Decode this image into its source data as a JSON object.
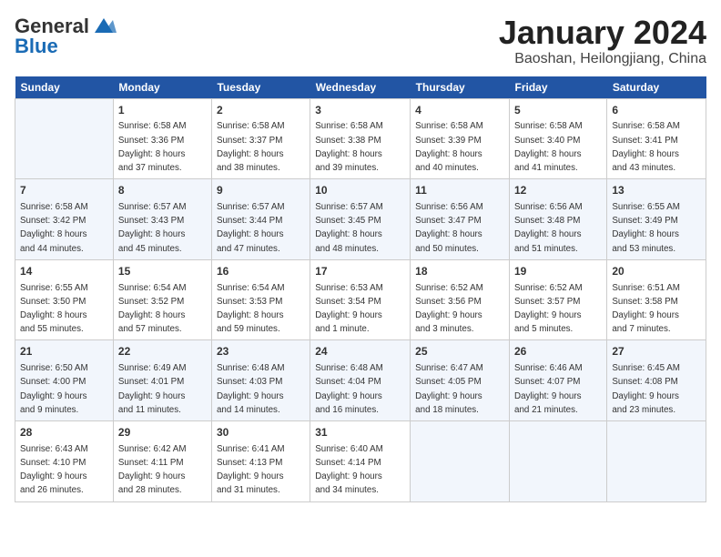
{
  "header": {
    "logo_general": "General",
    "logo_blue": "Blue",
    "month_year": "January 2024",
    "location": "Baoshan, Heilongjiang, China"
  },
  "days_of_week": [
    "Sunday",
    "Monday",
    "Tuesday",
    "Wednesday",
    "Thursday",
    "Friday",
    "Saturday"
  ],
  "weeks": [
    [
      {
        "day": "",
        "info": ""
      },
      {
        "day": "1",
        "info": "Sunrise: 6:58 AM\nSunset: 3:36 PM\nDaylight: 8 hours\nand 37 minutes."
      },
      {
        "day": "2",
        "info": "Sunrise: 6:58 AM\nSunset: 3:37 PM\nDaylight: 8 hours\nand 38 minutes."
      },
      {
        "day": "3",
        "info": "Sunrise: 6:58 AM\nSunset: 3:38 PM\nDaylight: 8 hours\nand 39 minutes."
      },
      {
        "day": "4",
        "info": "Sunrise: 6:58 AM\nSunset: 3:39 PM\nDaylight: 8 hours\nand 40 minutes."
      },
      {
        "day": "5",
        "info": "Sunrise: 6:58 AM\nSunset: 3:40 PM\nDaylight: 8 hours\nand 41 minutes."
      },
      {
        "day": "6",
        "info": "Sunrise: 6:58 AM\nSunset: 3:41 PM\nDaylight: 8 hours\nand 43 minutes."
      }
    ],
    [
      {
        "day": "7",
        "info": "Sunrise: 6:58 AM\nSunset: 3:42 PM\nDaylight: 8 hours\nand 44 minutes."
      },
      {
        "day": "8",
        "info": "Sunrise: 6:57 AM\nSunset: 3:43 PM\nDaylight: 8 hours\nand 45 minutes."
      },
      {
        "day": "9",
        "info": "Sunrise: 6:57 AM\nSunset: 3:44 PM\nDaylight: 8 hours\nand 47 minutes."
      },
      {
        "day": "10",
        "info": "Sunrise: 6:57 AM\nSunset: 3:45 PM\nDaylight: 8 hours\nand 48 minutes."
      },
      {
        "day": "11",
        "info": "Sunrise: 6:56 AM\nSunset: 3:47 PM\nDaylight: 8 hours\nand 50 minutes."
      },
      {
        "day": "12",
        "info": "Sunrise: 6:56 AM\nSunset: 3:48 PM\nDaylight: 8 hours\nand 51 minutes."
      },
      {
        "day": "13",
        "info": "Sunrise: 6:55 AM\nSunset: 3:49 PM\nDaylight: 8 hours\nand 53 minutes."
      }
    ],
    [
      {
        "day": "14",
        "info": "Sunrise: 6:55 AM\nSunset: 3:50 PM\nDaylight: 8 hours\nand 55 minutes."
      },
      {
        "day": "15",
        "info": "Sunrise: 6:54 AM\nSunset: 3:52 PM\nDaylight: 8 hours\nand 57 minutes."
      },
      {
        "day": "16",
        "info": "Sunrise: 6:54 AM\nSunset: 3:53 PM\nDaylight: 8 hours\nand 59 minutes."
      },
      {
        "day": "17",
        "info": "Sunrise: 6:53 AM\nSunset: 3:54 PM\nDaylight: 9 hours\nand 1 minute."
      },
      {
        "day": "18",
        "info": "Sunrise: 6:52 AM\nSunset: 3:56 PM\nDaylight: 9 hours\nand 3 minutes."
      },
      {
        "day": "19",
        "info": "Sunrise: 6:52 AM\nSunset: 3:57 PM\nDaylight: 9 hours\nand 5 minutes."
      },
      {
        "day": "20",
        "info": "Sunrise: 6:51 AM\nSunset: 3:58 PM\nDaylight: 9 hours\nand 7 minutes."
      }
    ],
    [
      {
        "day": "21",
        "info": "Sunrise: 6:50 AM\nSunset: 4:00 PM\nDaylight: 9 hours\nand 9 minutes."
      },
      {
        "day": "22",
        "info": "Sunrise: 6:49 AM\nSunset: 4:01 PM\nDaylight: 9 hours\nand 11 minutes."
      },
      {
        "day": "23",
        "info": "Sunrise: 6:48 AM\nSunset: 4:03 PM\nDaylight: 9 hours\nand 14 minutes."
      },
      {
        "day": "24",
        "info": "Sunrise: 6:48 AM\nSunset: 4:04 PM\nDaylight: 9 hours\nand 16 minutes."
      },
      {
        "day": "25",
        "info": "Sunrise: 6:47 AM\nSunset: 4:05 PM\nDaylight: 9 hours\nand 18 minutes."
      },
      {
        "day": "26",
        "info": "Sunrise: 6:46 AM\nSunset: 4:07 PM\nDaylight: 9 hours\nand 21 minutes."
      },
      {
        "day": "27",
        "info": "Sunrise: 6:45 AM\nSunset: 4:08 PM\nDaylight: 9 hours\nand 23 minutes."
      }
    ],
    [
      {
        "day": "28",
        "info": "Sunrise: 6:43 AM\nSunset: 4:10 PM\nDaylight: 9 hours\nand 26 minutes."
      },
      {
        "day": "29",
        "info": "Sunrise: 6:42 AM\nSunset: 4:11 PM\nDaylight: 9 hours\nand 28 minutes."
      },
      {
        "day": "30",
        "info": "Sunrise: 6:41 AM\nSunset: 4:13 PM\nDaylight: 9 hours\nand 31 minutes."
      },
      {
        "day": "31",
        "info": "Sunrise: 6:40 AM\nSunset: 4:14 PM\nDaylight: 9 hours\nand 34 minutes."
      },
      {
        "day": "",
        "info": ""
      },
      {
        "day": "",
        "info": ""
      },
      {
        "day": "",
        "info": ""
      }
    ]
  ]
}
